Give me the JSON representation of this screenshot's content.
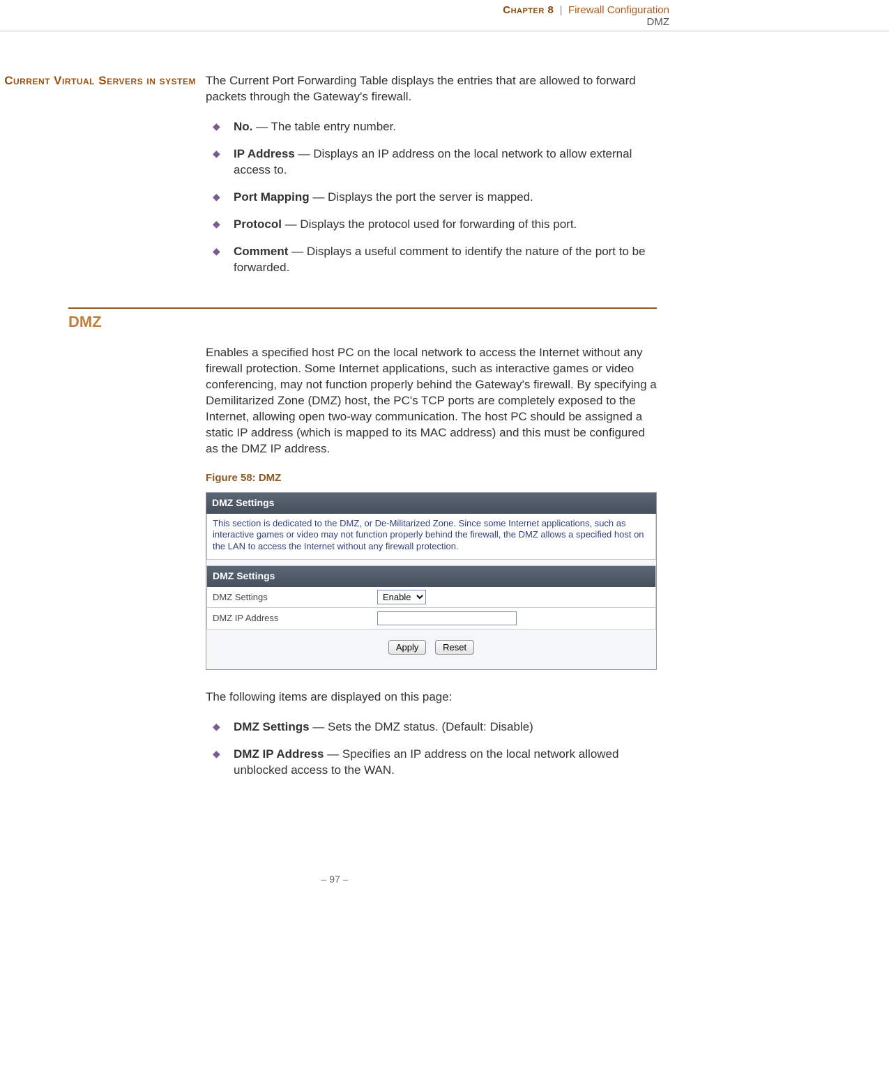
{
  "header": {
    "chapter_label": "Chapter 8",
    "separator": "|",
    "chapter_title": "Firewall Configuration",
    "subline": "DMZ"
  },
  "section1": {
    "side_heading": "Current Virtual Servers in system",
    "intro": "The Current Port Forwarding Table displays the entries that are allowed to forward packets through the Gateway's firewall.",
    "items": [
      {
        "term": "No.",
        "desc": " — The table entry number."
      },
      {
        "term": "IP Address",
        "desc": " — Displays an IP address on the local network to allow external access to."
      },
      {
        "term": "Port Mapping",
        "desc": " — Displays the port the server is mapped."
      },
      {
        "term": "Protocol",
        "desc": " — Displays the protocol used for forwarding of this port."
      },
      {
        "term": "Comment",
        "desc": " — Displays a useful comment to identify the nature of the port to be forwarded."
      }
    ]
  },
  "section2": {
    "heading": "DMZ",
    "intro": "Enables a specified host PC on the local network to access the Internet without any firewall protection. Some Internet applications, such as interactive games or video conferencing, may not function properly behind the Gateway's firewall. By specifying a Demilitarized Zone (DMZ) host, the PC's TCP ports are completely exposed to the Internet, allowing open two-way communication. The host PC should be assigned a static IP address (which is mapped to its MAC address) and this must be configured as the DMZ IP address.",
    "figure_caption": "Figure 58:  DMZ",
    "screenshot": {
      "panel_title": "DMZ Settings",
      "description": "This section is dedicated to the DMZ, or De-Militarized Zone. Since some Internet applications, such as interactive games or video may not function properly behind the firewall, the DMZ allows a specified host on the LAN to access the Internet without any firewall protection.",
      "table_title": "DMZ Settings",
      "rows": [
        {
          "label": "DMZ Settings",
          "type": "select",
          "value": "Enable"
        },
        {
          "label": "DMZ IP Address",
          "type": "text",
          "value": ""
        }
      ],
      "buttons": {
        "apply": "Apply",
        "reset": "Reset"
      }
    },
    "post_text": "The following items are displayed on this page:",
    "items": [
      {
        "term": "DMZ Settings",
        "desc": " — Sets the DMZ status. (Default: Disable)"
      },
      {
        "term": "DMZ IP Address",
        "desc": " — Specifies an IP address on the local network allowed unblocked access to the WAN."
      }
    ]
  },
  "footer": {
    "page_number": "–  97  –"
  }
}
